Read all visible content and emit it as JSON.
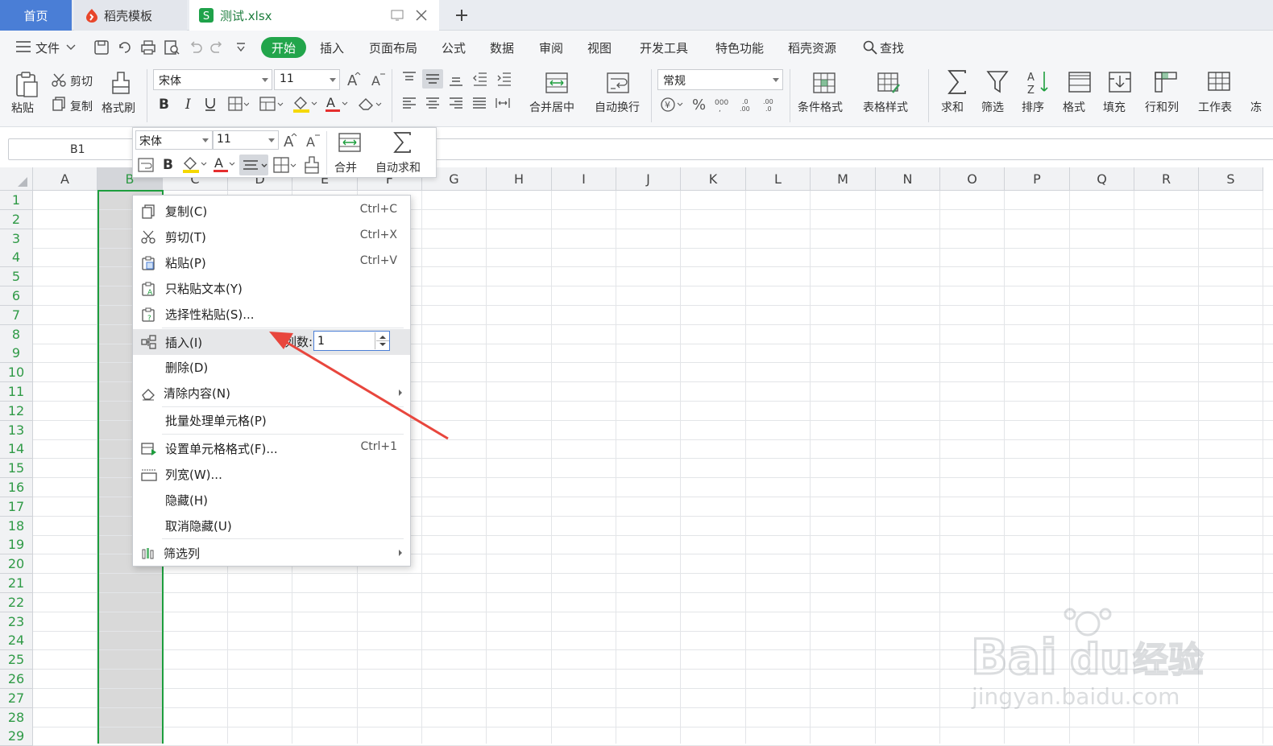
{
  "tabs": {
    "home": "首页",
    "template": "稻壳模板",
    "file": "测试.xlsx",
    "add": "+"
  },
  "menu": {
    "file": "文件",
    "items": [
      "开始",
      "插入",
      "页面布局",
      "公式",
      "数据",
      "审阅",
      "视图",
      "开发工具",
      "特色功能",
      "稻壳资源"
    ],
    "search": "查找"
  },
  "ribbon": {
    "paste": "粘贴",
    "cut": "剪切",
    "copy": "复制",
    "format_painter": "格式刷",
    "font_name": "宋体",
    "font_size": "11",
    "merge_center": "合并居中",
    "wrap_text": "自动换行",
    "number_format": "常规",
    "conditional_format": "条件格式",
    "table_style": "表格样式",
    "sum": "求和",
    "filter": "筛选",
    "sort": "排序",
    "format": "格式",
    "fill": "填充",
    "row_col": "行和列",
    "worksheet": "工作表",
    "freeze": "冻"
  },
  "namebox": "B1",
  "mini_toolbar": {
    "font_name": "宋体",
    "font_size": "11",
    "merge": "合并",
    "autosum": "自动求和"
  },
  "columns": [
    "A",
    "B",
    "C",
    "D",
    "E",
    "F",
    "G",
    "H",
    "I",
    "J",
    "K",
    "L",
    "M",
    "N",
    "O",
    "P",
    "Q",
    "R",
    "S"
  ],
  "rows": [
    "1",
    "2",
    "3",
    "4",
    "5",
    "6",
    "7",
    "8",
    "9",
    "10",
    "11",
    "12",
    "13",
    "14",
    "15",
    "16",
    "17",
    "18",
    "19",
    "20",
    "21",
    "22",
    "23",
    "24",
    "25",
    "26",
    "27",
    "28",
    "29"
  ],
  "context_menu": {
    "copy": {
      "label": "复制(C)",
      "shortcut": "Ctrl+C"
    },
    "cut": {
      "label": "剪切(T)",
      "shortcut": "Ctrl+X"
    },
    "paste": {
      "label": "粘贴(P)",
      "shortcut": "Ctrl+V"
    },
    "paste_text": {
      "label": "只粘贴文本(Y)"
    },
    "paste_special": {
      "label": "选择性粘贴(S)..."
    },
    "insert": {
      "label": "插入(I)",
      "count_label": "列数:",
      "count_value": "1"
    },
    "delete": {
      "label": "删除(D)"
    },
    "clear": {
      "label": "清除内容(N)"
    },
    "batch": {
      "label": "批量处理单元格(P)"
    },
    "format_cells": {
      "label": "设置单元格格式(F)...",
      "shortcut": "Ctrl+1"
    },
    "col_width": {
      "label": "列宽(W)..."
    },
    "hide": {
      "label": "隐藏(H)"
    },
    "unhide": {
      "label": "取消隐藏(U)"
    },
    "filter_col": {
      "label": "筛选列"
    }
  },
  "colors": {
    "accent_green": "#22a54b",
    "tab_blue": "#4a7ed6",
    "arrow_red": "#e8463d"
  },
  "watermark": {
    "brand": "Bai  du 经验",
    "url": "jingyan.baidu.com"
  }
}
